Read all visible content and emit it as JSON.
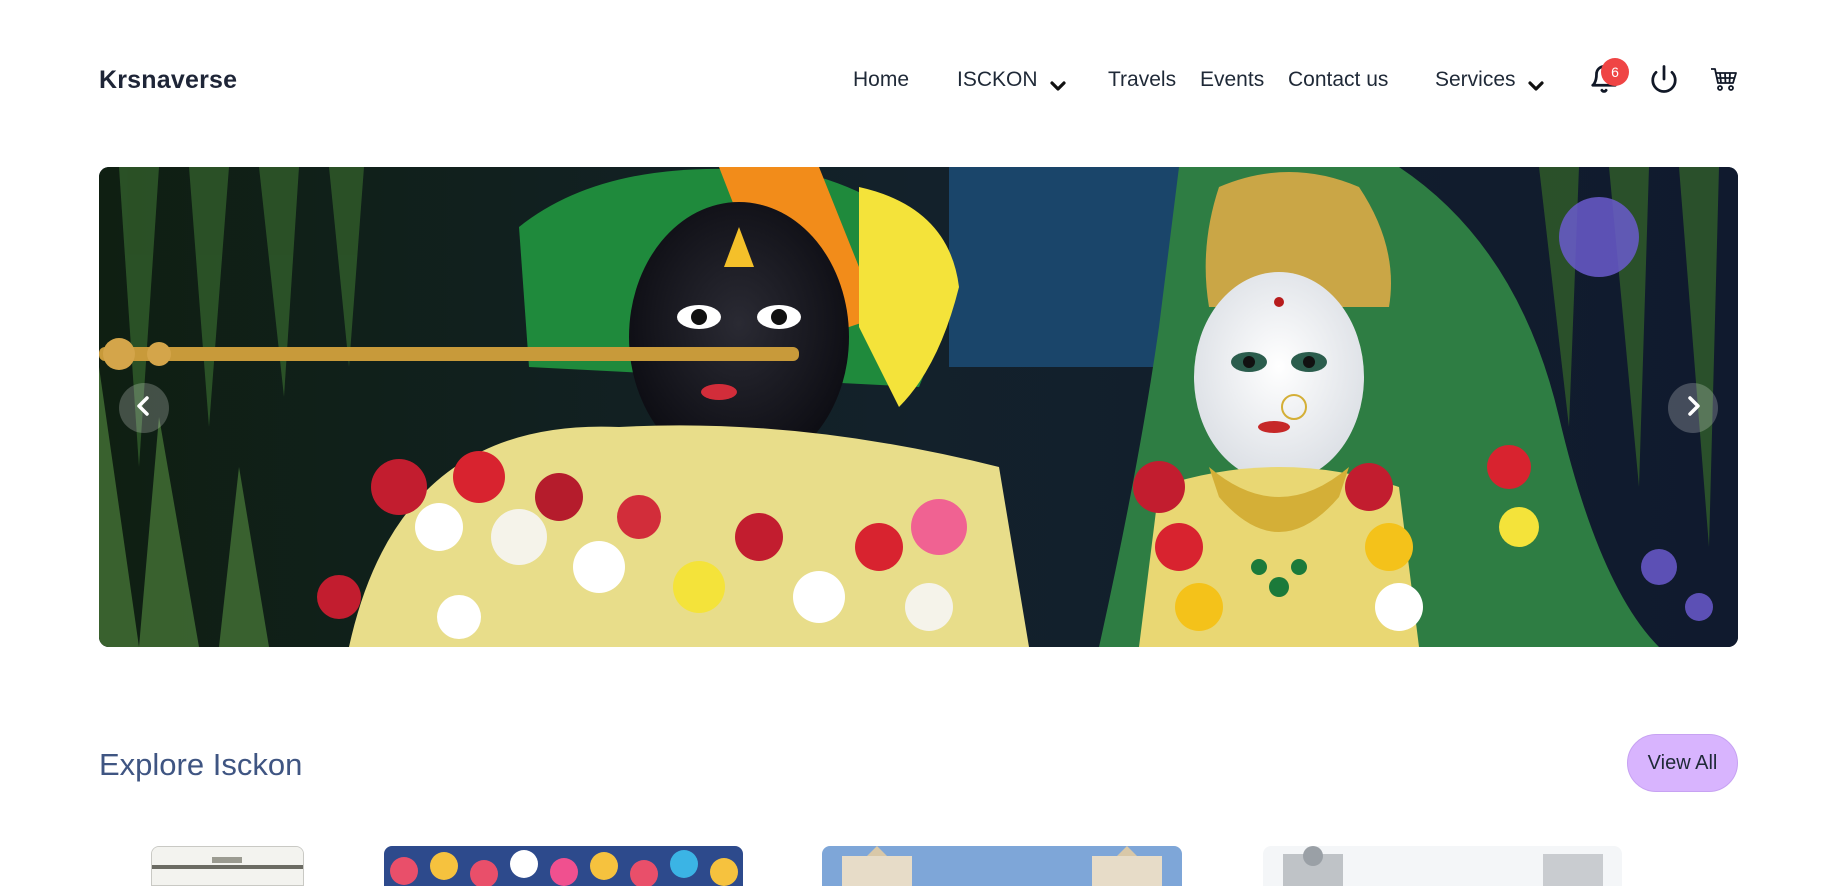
{
  "brand": {
    "name": "Krsnaverse"
  },
  "nav": {
    "items": [
      {
        "label": "Home",
        "has_dropdown": false
      },
      {
        "label": "ISCKON",
        "has_dropdown": true
      },
      {
        "label": "Travels",
        "has_dropdown": false
      },
      {
        "label": "Events",
        "has_dropdown": false
      },
      {
        "label": "Contact us",
        "has_dropdown": false
      },
      {
        "label": "Services",
        "has_dropdown": true
      }
    ],
    "icons": {
      "notifications": "bell-icon",
      "power": "power-icon",
      "cart": "cart-icon"
    },
    "notification_count": "6"
  },
  "carousel": {
    "prev_icon": "chevron-left-icon",
    "next_icon": "chevron-right-icon"
  },
  "explore": {
    "title": "Explore Isckon",
    "view_all_label": "View All"
  },
  "colors": {
    "brand_text": "#1e2537",
    "section_title": "#3f5582",
    "view_all_bg": "#d8b4fe",
    "badge_bg": "#ef4444"
  }
}
